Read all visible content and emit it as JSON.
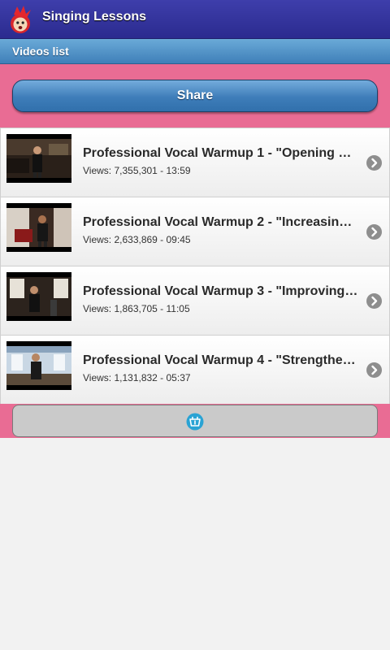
{
  "app": {
    "title": "Singing Lessons"
  },
  "subheader": {
    "label": "Videos list"
  },
  "share": {
    "label": "Share"
  },
  "videos": [
    {
      "title": "Professional Vocal Warmup 1 - \"Opening U…",
      "meta": "Views: 7,355,301 - 13:59"
    },
    {
      "title": "Professional Vocal Warmup 2 - \"Increasing…",
      "meta": "Views: 2,633,869 - 09:45"
    },
    {
      "title": "Professional Vocal Warmup 3 - \"Improving…",
      "meta": "Views: 1,863,705 - 11:05"
    },
    {
      "title": "Professional Vocal Warmup 4 - \"Strengthe…",
      "meta": "Views: 1,131,832 - 05:37"
    }
  ],
  "icons": {
    "app": "mascot-icon",
    "row_arrow": "chevron-right-icon",
    "bottom": "store-icon"
  },
  "colors": {
    "titlebar": "#2f2f95",
    "subheader": "#4f8fc8",
    "band": "#e96c94",
    "share_button": "#3e7db9",
    "chevron": "#8e8e8e"
  }
}
